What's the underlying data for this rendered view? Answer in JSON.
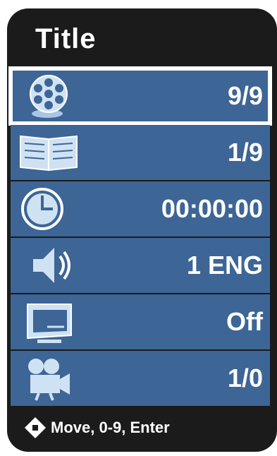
{
  "title": "Title",
  "items": [
    {
      "icon": "film-reel-icon",
      "value": "9/9"
    },
    {
      "icon": "book-icon",
      "value": "1/9"
    },
    {
      "icon": "clock-icon",
      "value": "00:00:00"
    },
    {
      "icon": "speaker-icon",
      "value": "1 ENG"
    },
    {
      "icon": "subtitle-screen-icon",
      "value": "Off"
    },
    {
      "icon": "camera-angle-icon",
      "value": "1/0"
    }
  ],
  "footer": {
    "hint": "Move, 0-9, Enter"
  },
  "colors": {
    "panel": "#1b1b1b",
    "row": "#3d6595",
    "selection": "#ffffff"
  }
}
